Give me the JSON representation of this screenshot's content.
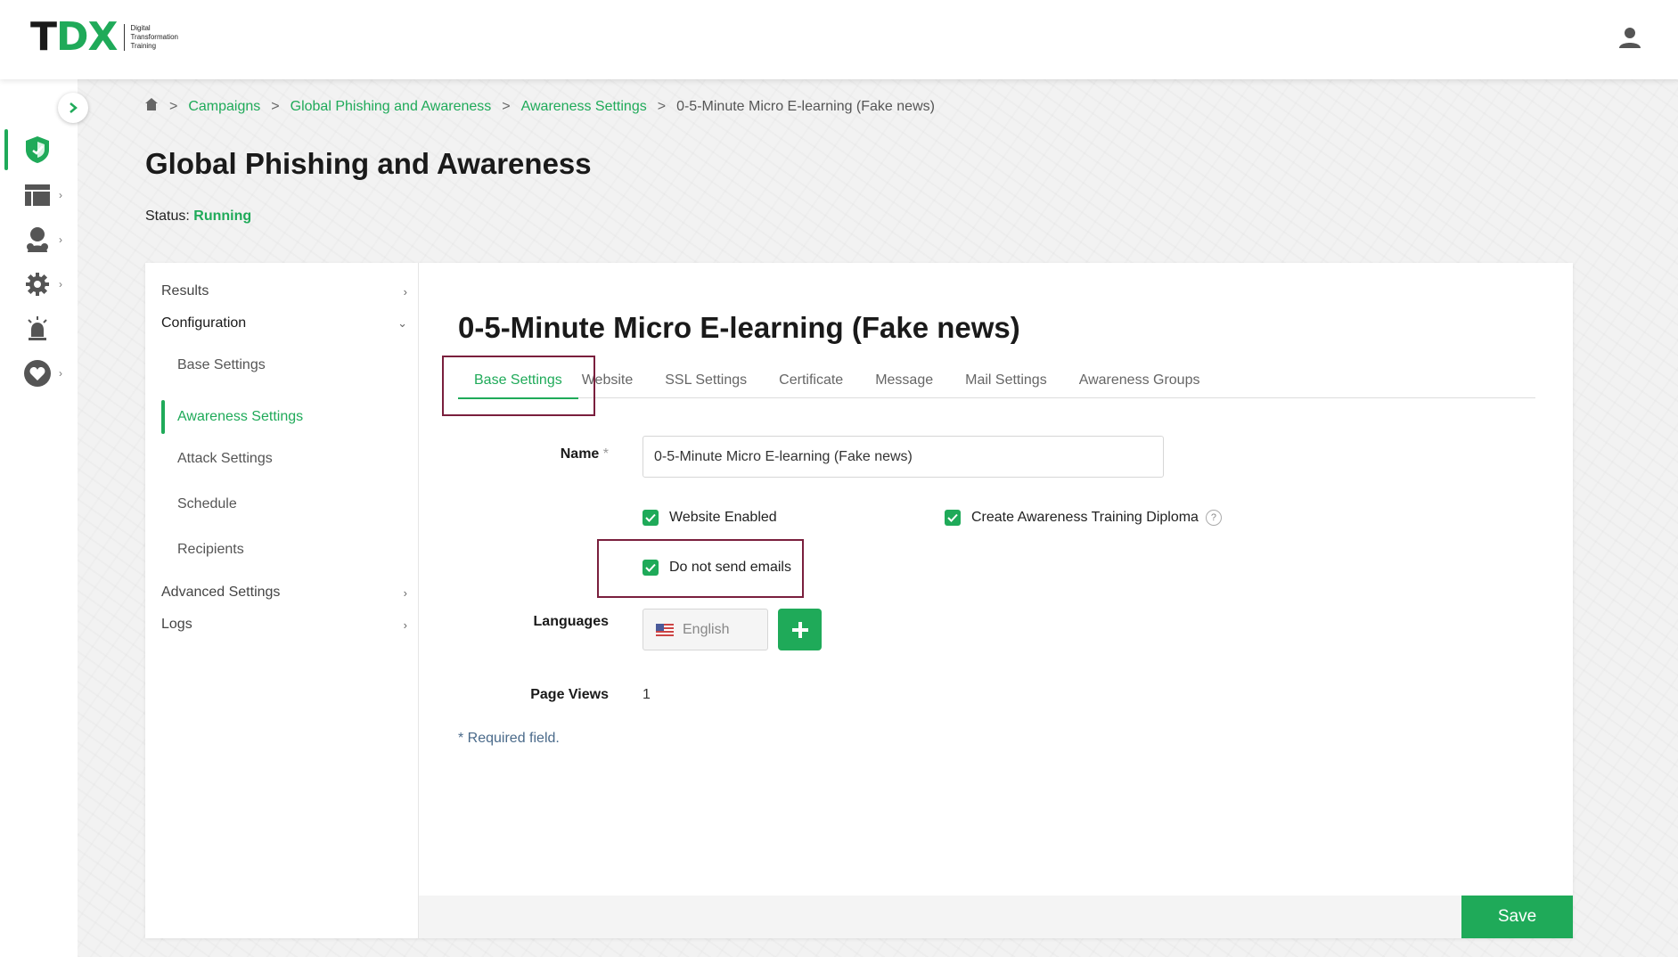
{
  "header": {
    "logo_main_t": "T",
    "logo_main_dx": "DX",
    "logo_sub": [
      "Digital",
      "Transformation",
      "Training"
    ],
    "user_icon": "user-icon"
  },
  "rail": {
    "items": [
      {
        "icon": "shield-icon",
        "active": true
      },
      {
        "icon": "layout-icon",
        "chevron": "›"
      },
      {
        "icon": "users-icon",
        "chevron": "›"
      },
      {
        "icon": "gear-icon",
        "chevron": "›"
      },
      {
        "icon": "alarm-icon"
      },
      {
        "icon": "heart-icon",
        "chevron": "›"
      }
    ]
  },
  "breadcrumb": {
    "sep": ">",
    "items": [
      "Campaigns",
      "Global Phishing and Awareness",
      "Awareness Settings"
    ],
    "current": "0-5-Minute Micro E-learning (Fake news)"
  },
  "page": {
    "title": "Global Phishing and Awareness",
    "status_label": "Status:",
    "status_value": "Running"
  },
  "sidenav": {
    "results": "Results",
    "configuration": "Configuration",
    "sub_items": [
      "Base Settings",
      "Awareness Settings",
      "Attack Settings",
      "Schedule",
      "Recipients"
    ],
    "advanced": "Advanced Settings",
    "logs": "Logs"
  },
  "content": {
    "title": "0-5-Minute Micro E-learning (Fake news)",
    "tabs": [
      "Base Settings",
      "Website",
      "SSL Settings",
      "Certificate",
      "Message",
      "Mail Settings",
      "Awareness Groups"
    ],
    "name_label": "Name",
    "required_mark": "*",
    "name_value": "0-5-Minute Micro E-learning (Fake news)",
    "website_enabled": "Website Enabled",
    "create_diploma": "Create Awareness Training Diploma",
    "help": "?",
    "do_not_send": "Do not send emails",
    "languages_label": "Languages",
    "language": "English",
    "add": "+",
    "page_views_label": "Page Views",
    "page_views_value": "1",
    "required_note": "* Required field.",
    "save": "Save"
  },
  "colors": {
    "accent": "#1faa59",
    "highlight": "#7a1f3d"
  }
}
